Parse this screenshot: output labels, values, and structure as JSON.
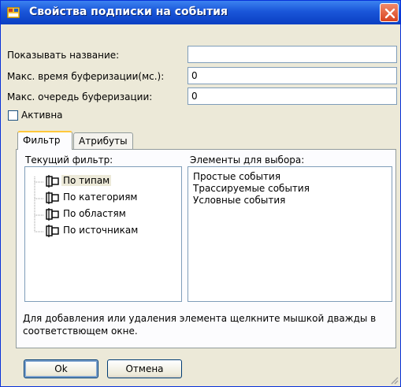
{
  "window": {
    "title": "Свойства подписки на события"
  },
  "form": {
    "show_name_label": "Показывать название:",
    "show_name_value": "",
    "max_buffer_time_label": "Макс. время буферизации(мс.):",
    "max_buffer_time_value": "0",
    "max_buffer_queue_label": "Макс. очередь буферизации:",
    "max_buffer_queue_value": "0",
    "active_label": "Активна",
    "active_checked": false
  },
  "tabs": [
    {
      "label": "Фильтр",
      "active": true
    },
    {
      "label": "Атрибуты",
      "active": false
    }
  ],
  "filter": {
    "current_filter_label": "Текущий фильтр:",
    "tree_items": [
      {
        "label": "По типам",
        "selected": true
      },
      {
        "label": "По категориям",
        "selected": false
      },
      {
        "label": "По областям",
        "selected": false
      },
      {
        "label": "По источникам",
        "selected": false
      }
    ],
    "available_label": "Элементы для выбора:",
    "available_items": [
      "Простые события",
      "Трассируемые события",
      "Условные события"
    ],
    "hint": "Для добавления или удаления элемента щелкните мышкой дважды в соответствющем окне."
  },
  "buttons": {
    "ok": "Ok",
    "cancel": "Отмена"
  },
  "colors": {
    "titlebar": "#1a56d9",
    "dialog_bg": "#ece9d8",
    "close_button": "#d9431f"
  },
  "icons": {
    "title": "app-window-icon",
    "close": "close-icon",
    "tree_node": "filter-node-icon"
  }
}
